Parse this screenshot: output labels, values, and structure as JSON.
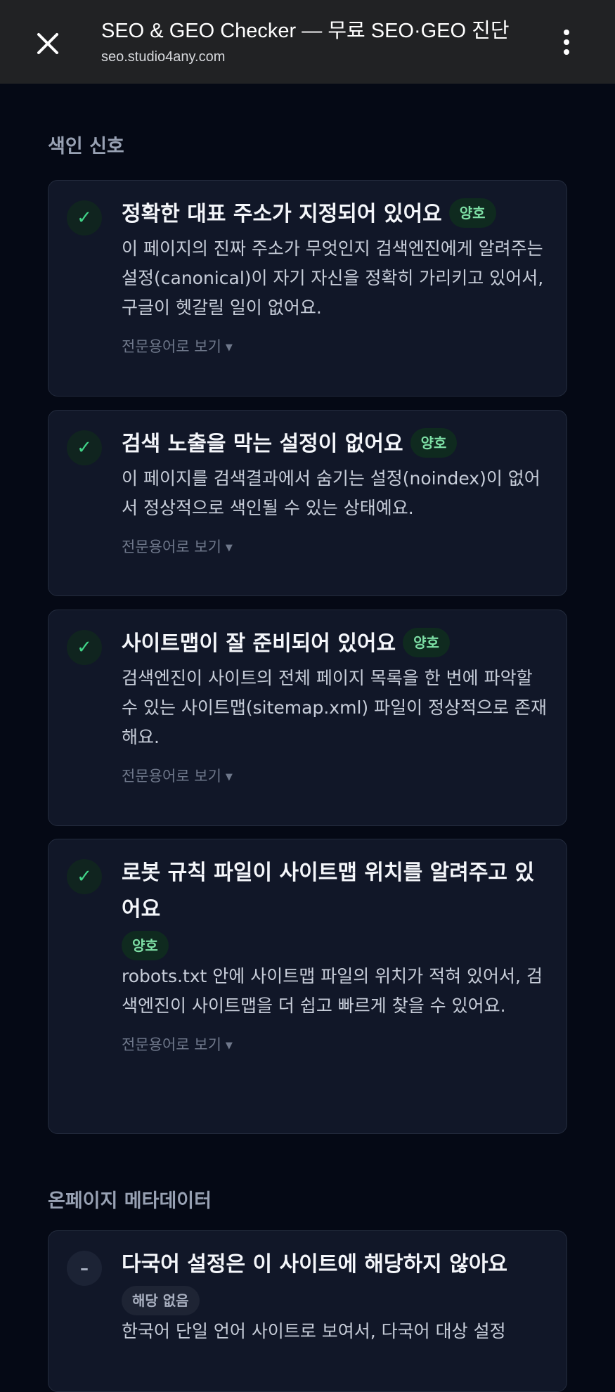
{
  "topbar": {
    "title": "SEO & GEO Checker — 무료 SEO·GEO 진단",
    "url": "seo.studio4any.com"
  },
  "sections": [
    {
      "heading": "색인 신호",
      "cards": [
        {
          "status": "pass",
          "title": "정확한 대표 주소가 지정되어 있어요",
          "badge": "양호",
          "description": "이 페이지의 진짜 주소가 무엇인지 검색엔진에게 알려주는 설정(canonical)이 자기 자신을 정확히 가리키고 있어서, 구글이 헷갈릴 일이 없어요.",
          "toggle": "전문용어로 보기"
        },
        {
          "status": "pass",
          "title": "검색 노출을 막는 설정이 없어요",
          "badge": "양호",
          "description": "이 페이지를 검색결과에서 숨기는 설정(noindex)이 없어서 정상적으로 색인될 수 있는 상태예요.",
          "toggle": "전문용어로 보기"
        },
        {
          "status": "pass",
          "title": "사이트맵이 잘 준비되어 있어요",
          "badge": "양호",
          "description": "검색엔진이 사이트의 전체 페이지 목록을 한 번에 파악할 수 있는 사이트맵(sitemap.xml) 파일이 정상적으로 존재해요.",
          "toggle": "전문용어로 보기"
        },
        {
          "status": "pass",
          "title": "로봇 규칙 파일이 사이트맵 위치를 알려주고 있어요",
          "badge": "양호",
          "description": "robots.txt 안에 사이트맵 파일의 위치가 적혀 있어서, 검색엔진이 사이트맵을 더 쉽고 빠르게 찾을 수 있어요.",
          "toggle": "전문용어로 보기"
        }
      ]
    },
    {
      "heading": "온페이지 메타데이터",
      "cards": [
        {
          "status": "na",
          "title": "다국어 설정은 이 사이트에 해당하지 않아요",
          "badge": "해당 없음",
          "description": "한국어 단일 언어 사이트로 보여서, 다국어 대상 설정"
        }
      ]
    }
  ],
  "icons": {
    "close": "close-icon",
    "menu": "more-vertical-icon",
    "check": "check-icon",
    "dash": "dash-icon"
  },
  "colors": {
    "background": "#050915",
    "topbar": "#212224",
    "card": "#111728",
    "pass_green": "#41d488",
    "badge_bg": "#0f2a1f"
  }
}
